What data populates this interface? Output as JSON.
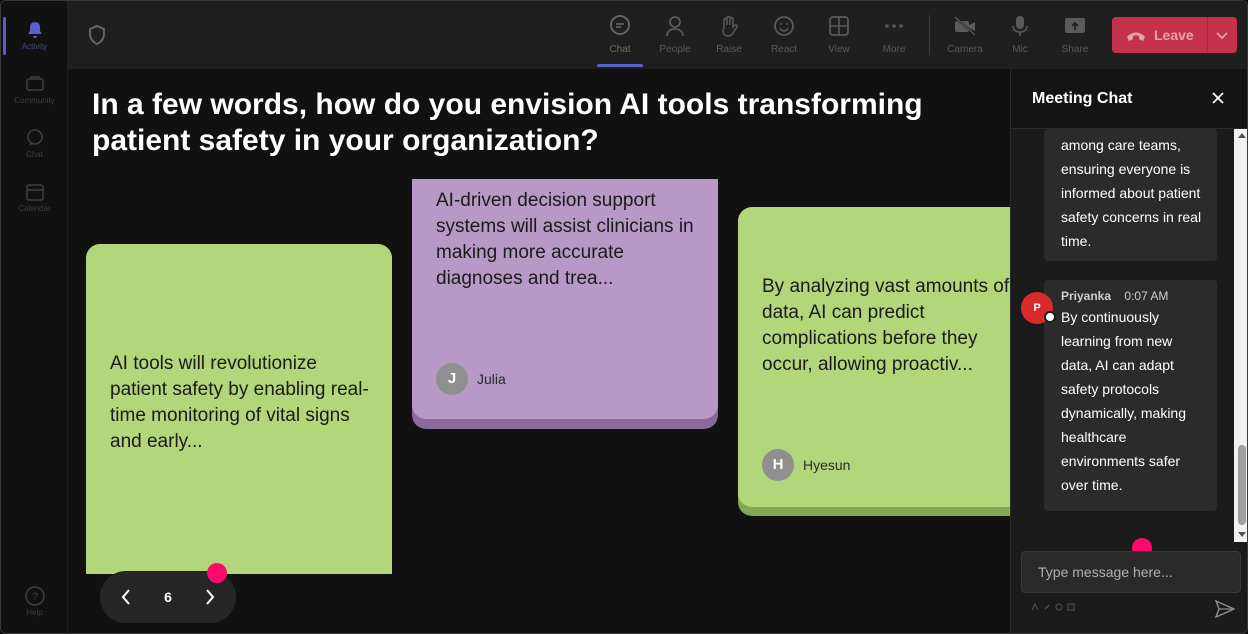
{
  "rail": {
    "items": [
      {
        "label": "Activity"
      },
      {
        "label": "Community"
      },
      {
        "label": "Chat"
      },
      {
        "label": "Calendar"
      }
    ],
    "help_label": "Help"
  },
  "toolbar": {
    "buttons": [
      {
        "label": "Chat"
      },
      {
        "label": "People"
      },
      {
        "label": "Raise"
      },
      {
        "label": "React"
      },
      {
        "label": "View"
      },
      {
        "label": "More"
      },
      {
        "label": "Camera"
      },
      {
        "label": "Mic"
      },
      {
        "label": "Share"
      }
    ],
    "leave_label": "Leave"
  },
  "stage": {
    "question": "In a few words, how do you envision AI tools transforming patient safety in your organization?",
    "cards": [
      {
        "text": "AI tools will revolutionize patient safety by enabling real-time monitoring of vital signs and early...",
        "author": ""
      },
      {
        "text": "AI-driven decision support systems will assist clinicians in making more accurate diagnoses and trea...",
        "author": "Julia",
        "initial": "J"
      },
      {
        "text": "By analyzing vast amounts of data, AI can predict complications before they occur, allowing proactiv...",
        "author": "Hyesun",
        "initial": "H"
      }
    ],
    "page_number": "6"
  },
  "chat": {
    "title": "Meeting Chat",
    "messages": [
      {
        "text": "among care teams, ensuring everyone is informed about patient safety concerns in real time."
      },
      {
        "sender": "Priyanka",
        "initial": "P",
        "time": "0:07 AM",
        "text": "By continuously learning from new data, AI can adapt safety protocols dynamically, making healthcare environments safer over time."
      }
    ],
    "input_placeholder": "Type message here..."
  },
  "colors": {
    "accent": "#5b5fc7",
    "leave": "#c4314b",
    "card_green": "#b2d67a",
    "card_purple": "#b899c6",
    "cursor_dot": "#ff0a6c"
  }
}
